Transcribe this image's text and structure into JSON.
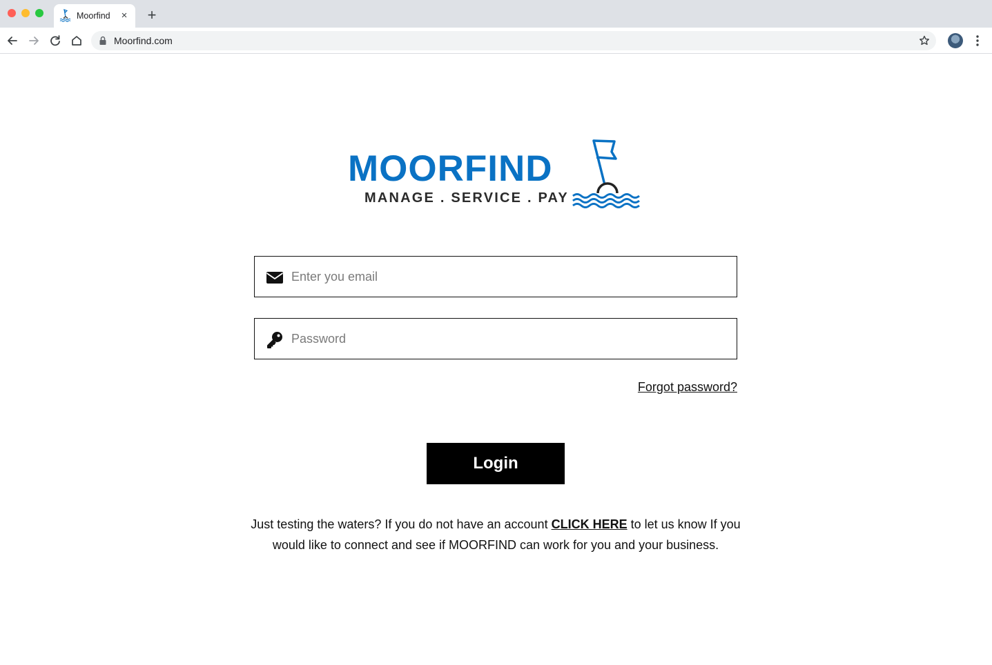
{
  "browser": {
    "tab_title": "Moorfind",
    "tab_close": "×",
    "new_tab": "+",
    "url": "Moorfind.com"
  },
  "logo": {
    "name": "MOORFIND",
    "tagline": "MANAGE . SERVICE . PAY",
    "brand_color": "#0a72c4"
  },
  "login_form": {
    "email_placeholder": "Enter you email",
    "password_placeholder": "Password",
    "forgot_label": "Forgot password?",
    "login_label": "Login"
  },
  "signup": {
    "text_before": "Just testing the waters? If you do not have an account ",
    "link_label": "CLICK HERE",
    "text_after": " to let us know If you would like to connect and see if MOORFIND can work for you and your business."
  }
}
